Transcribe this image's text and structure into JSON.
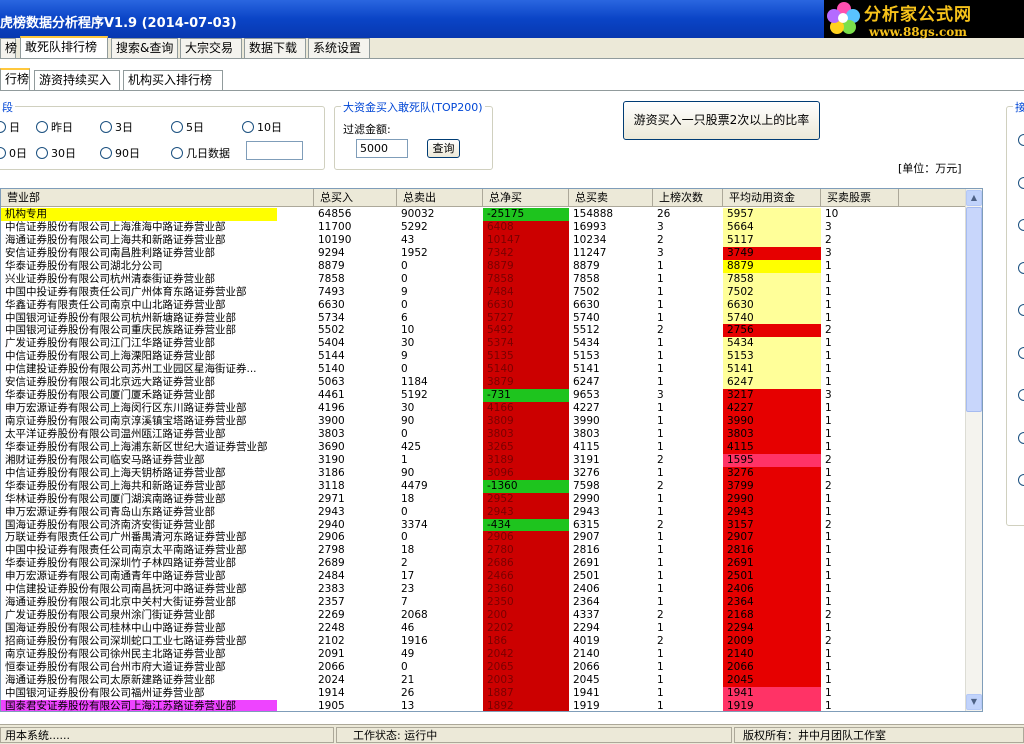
{
  "app": {
    "title": "虎榜数据分析程序V1.9 (2014-07-03)"
  },
  "logo": {
    "text": "分析家公式网",
    "url": "www.88gs.com"
  },
  "main_tabs": [
    "榜",
    "敢死队排行榜",
    "搜索&查询",
    "大宗交易",
    "数据下载",
    "系统设置"
  ],
  "sub_tabs": [
    "行榜",
    "游资持续买入",
    "机构买入排行榜"
  ],
  "period": {
    "legend": "段",
    "options": [
      "日",
      "昨日",
      "3日",
      "5日",
      "10日",
      "0日",
      "30日",
      "90日",
      "几日数据"
    ],
    "days_value": ""
  },
  "filter": {
    "legend": "大资金买入敢死队(TOP200)",
    "label": "过滤金额:",
    "value": "5000",
    "query_button": "查询"
  },
  "ratio_button": "游资买入一只股票2次以上的比率",
  "right_legend": "接",
  "unit": "[单位：万元]",
  "columns": [
    "营业部",
    "总买入",
    "总卖出",
    "总净买",
    "总买卖",
    "上榜次数",
    "平均动用资金",
    "买卖股票"
  ],
  "colors": {
    "yellow": "#ffff00",
    "light_yellow": "#ffff99",
    "red": "#cc0000",
    "deep_red": "#e60000",
    "green": "#1ec41e",
    "pink": "#ff3366",
    "magenta": "#ee44ff"
  },
  "rows": [
    [
      "机构专用",
      "64856",
      "90032",
      "-25175",
      "154888",
      "26",
      "5957",
      "10",
      "yellow",
      "green",
      "light_yellow"
    ],
    [
      "中信证券股份有限公司上海淮海中路证券营业部",
      "11700",
      "5292",
      "6408",
      "16993",
      "3",
      "5664",
      "3",
      "",
      "red",
      "light_yellow"
    ],
    [
      "海通证券股份有限公司上海共和新路证券营业部",
      "10190",
      "43",
      "10147",
      "10234",
      "2",
      "5117",
      "2",
      "",
      "red",
      "light_yellow"
    ],
    [
      "安信证券股份有限公司南昌胜利路证券营业部",
      "9294",
      "1952",
      "7342",
      "11247",
      "3",
      "3749",
      "3",
      "",
      "red",
      "red"
    ],
    [
      "华泰证券股份有限公司湖北分公司",
      "8879",
      "0",
      "8879",
      "8879",
      "1",
      "8879",
      "1",
      "",
      "red",
      "yellow"
    ],
    [
      "兴业证券股份有限公司杭州清泰街证券营业部",
      "7858",
      "0",
      "7858",
      "7858",
      "1",
      "7858",
      "1",
      "",
      "red",
      "light_yellow"
    ],
    [
      "中国中投证券有限责任公司广州体育东路证券营业部",
      "7493",
      "9",
      "7484",
      "7502",
      "1",
      "7502",
      "1",
      "",
      "red",
      "light_yellow"
    ],
    [
      "华鑫证券有限责任公司南京中山北路证券营业部",
      "6630",
      "0",
      "6630",
      "6630",
      "1",
      "6630",
      "1",
      "",
      "red",
      "light_yellow"
    ],
    [
      "中国银河证券股份有限公司杭州新塘路证券营业部",
      "5734",
      "6",
      "5727",
      "5740",
      "1",
      "5740",
      "1",
      "",
      "red",
      "light_yellow"
    ],
    [
      "中国银河证券股份有限公司重庆民族路证券营业部",
      "5502",
      "10",
      "5492",
      "5512",
      "2",
      "2756",
      "2",
      "",
      "red",
      "red"
    ],
    [
      "广发证券股份有限公司江门江华路证券营业部",
      "5404",
      "30",
      "5374",
      "5434",
      "1",
      "5434",
      "1",
      "",
      "red",
      "light_yellow"
    ],
    [
      "中信证券股份有限公司上海溧阳路证券营业部",
      "5144",
      "9",
      "5135",
      "5153",
      "1",
      "5153",
      "1",
      "",
      "red",
      "light_yellow"
    ],
    [
      "中信建投证券股份有限公司苏州工业园区星海街证券...",
      "5140",
      "0",
      "5140",
      "5141",
      "1",
      "5141",
      "1",
      "",
      "red",
      "light_yellow"
    ],
    [
      "安信证券股份有限公司北京远大路证券营业部",
      "5063",
      "1184",
      "3879",
      "6247",
      "1",
      "6247",
      "1",
      "",
      "red",
      "light_yellow"
    ],
    [
      "华泰证券股份有限公司厦门厦禾路证券营业部",
      "4461",
      "5192",
      "-731",
      "9653",
      "3",
      "3217",
      "3",
      "",
      "green",
      "red"
    ],
    [
      "申万宏源证券有限公司上海闵行区东川路证券营业部",
      "4196",
      "30",
      "4166",
      "4227",
      "1",
      "4227",
      "1",
      "",
      "red",
      "red"
    ],
    [
      "南京证券股份有限公司南京淳溪镇宝塔路证券营业部",
      "3900",
      "90",
      "3809",
      "3990",
      "1",
      "3990",
      "1",
      "",
      "red",
      "red"
    ],
    [
      "太平洋证券股份有限公司温州瓯江路证券营业部",
      "3803",
      "0",
      "3803",
      "3803",
      "1",
      "3803",
      "1",
      "",
      "red",
      "red"
    ],
    [
      "华泰证券股份有限公司上海浦东新区世纪大道证券营业部",
      "3690",
      "425",
      "3265",
      "4115",
      "1",
      "4115",
      "1",
      "",
      "red",
      "red"
    ],
    [
      "湘财证券股份有限公司临安马路证券营业部",
      "3190",
      "1",
      "3189",
      "3191",
      "2",
      "1595",
      "2",
      "",
      "red",
      "pink"
    ],
    [
      "中信证券股份有限公司上海天钥桥路证券营业部",
      "3186",
      "90",
      "3096",
      "3276",
      "1",
      "3276",
      "1",
      "",
      "red",
      "red"
    ],
    [
      "华泰证券股份有限公司上海共和新路证券营业部",
      "3118",
      "4479",
      "-1360",
      "7598",
      "2",
      "3799",
      "2",
      "",
      "green",
      "red"
    ],
    [
      "华林证券股份有限公司厦门湖滨南路证券营业部",
      "2971",
      "18",
      "2952",
      "2990",
      "1",
      "2990",
      "1",
      "",
      "red",
      "red"
    ],
    [
      "申万宏源证券有限公司青岛山东路证券营业部",
      "2943",
      "0",
      "2943",
      "2943",
      "1",
      "2943",
      "1",
      "",
      "red",
      "red"
    ],
    [
      "国海证券股份有限公司济南济安街证券营业部",
      "2940",
      "3374",
      "-434",
      "6315",
      "2",
      "3157",
      "2",
      "",
      "green",
      "red"
    ],
    [
      "万联证券有限责任公司广州番禺清河东路证券营业部",
      "2906",
      "0",
      "2906",
      "2907",
      "1",
      "2907",
      "1",
      "",
      "red",
      "red"
    ],
    [
      "中国中投证券有限责任公司南京太平南路证券营业部",
      "2798",
      "18",
      "2780",
      "2816",
      "1",
      "2816",
      "1",
      "",
      "red",
      "red"
    ],
    [
      "华泰证券股份有限公司深圳竹子林四路证券营业部",
      "2689",
      "2",
      "2686",
      "2691",
      "1",
      "2691",
      "1",
      "",
      "red",
      "red"
    ],
    [
      "申万宏源证券有限公司南通青年中路证券营业部",
      "2484",
      "17",
      "2466",
      "2501",
      "1",
      "2501",
      "1",
      "",
      "red",
      "red"
    ],
    [
      "中信建投证券股份有限公司南昌抚河中路证券营业部",
      "2383",
      "23",
      "2360",
      "2406",
      "1",
      "2406",
      "1",
      "",
      "red",
      "red"
    ],
    [
      "海通证券股份有限公司北京中关村大街证券营业部",
      "2357",
      "7",
      "2350",
      "2364",
      "1",
      "2364",
      "1",
      "",
      "red",
      "red"
    ],
    [
      "广发证券股份有限公司泉州涂门街证券营业部",
      "2269",
      "2068",
      "200",
      "4337",
      "2",
      "2168",
      "2",
      "",
      "red",
      "red"
    ],
    [
      "国海证券股份有限公司桂林中山中路证券营业部",
      "2248",
      "46",
      "2202",
      "2294",
      "1",
      "2294",
      "1",
      "",
      "red",
      "red"
    ],
    [
      "招商证券股份有限公司深圳蛇口工业七路证券营业部",
      "2102",
      "1916",
      "186",
      "4019",
      "2",
      "2009",
      "2",
      "",
      "red",
      "red"
    ],
    [
      "南京证券股份有限公司徐州民主北路证券营业部",
      "2091",
      "49",
      "2042",
      "2140",
      "1",
      "2140",
      "1",
      "",
      "red",
      "red"
    ],
    [
      "恒泰证券股份有限公司台州市府大道证券营业部",
      "2066",
      "0",
      "2065",
      "2066",
      "1",
      "2066",
      "1",
      "",
      "red",
      "red"
    ],
    [
      "海通证券股份有限公司太原新建路证券营业部",
      "2024",
      "21",
      "2003",
      "2045",
      "1",
      "2045",
      "1",
      "",
      "red",
      "red"
    ],
    [
      "中国银河证券股份有限公司福州证券营业部",
      "1914",
      "26",
      "1887",
      "1941",
      "1",
      "1941",
      "1",
      "",
      "red",
      "pink"
    ],
    [
      "国泰君安证券股份有限公司上海江苏路证券营业部",
      "1905",
      "13",
      "1892",
      "1919",
      "1",
      "1919",
      "1",
      "magenta",
      "red",
      "pink"
    ]
  ],
  "status": {
    "left": "用本系统......",
    "work": "工作状态: 运行中",
    "copyright": "版权所有：井中月团队工作室"
  }
}
